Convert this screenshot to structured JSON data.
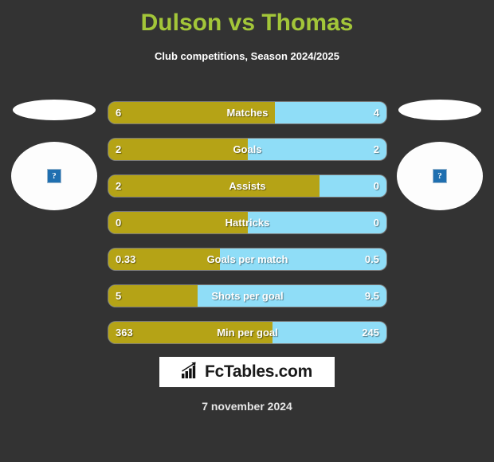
{
  "header": {
    "title": "Dulson vs Thomas",
    "subtitle": "Club competitions, Season 2024/2025",
    "title_color": "#A3C639"
  },
  "teams": {
    "home": {
      "placeholder_glyph": "?"
    },
    "away": {
      "placeholder_glyph": "?"
    }
  },
  "colors": {
    "background": "#333333",
    "home_bar": "#B5A316",
    "away_bar": "#8FDDF7",
    "text": "#ffffff"
  },
  "stats": [
    {
      "label": "Matches",
      "home": "6",
      "away": "4",
      "home_pct": 60
    },
    {
      "label": "Goals",
      "home": "2",
      "away": "2",
      "home_pct": 50
    },
    {
      "label": "Assists",
      "home": "2",
      "away": "0",
      "home_pct": 76
    },
    {
      "label": "Hattricks",
      "home": "0",
      "away": "0",
      "home_pct": 50
    },
    {
      "label": "Goals per match",
      "home": "0.33",
      "away": "0.5",
      "home_pct": 40
    },
    {
      "label": "Shots per goal",
      "home": "5",
      "away": "9.5",
      "home_pct": 32
    },
    {
      "label": "Min per goal",
      "home": "363",
      "away": "245",
      "home_pct": 59
    }
  ],
  "footer": {
    "logo_text": "FcTables.com",
    "date": "7 november 2024"
  }
}
